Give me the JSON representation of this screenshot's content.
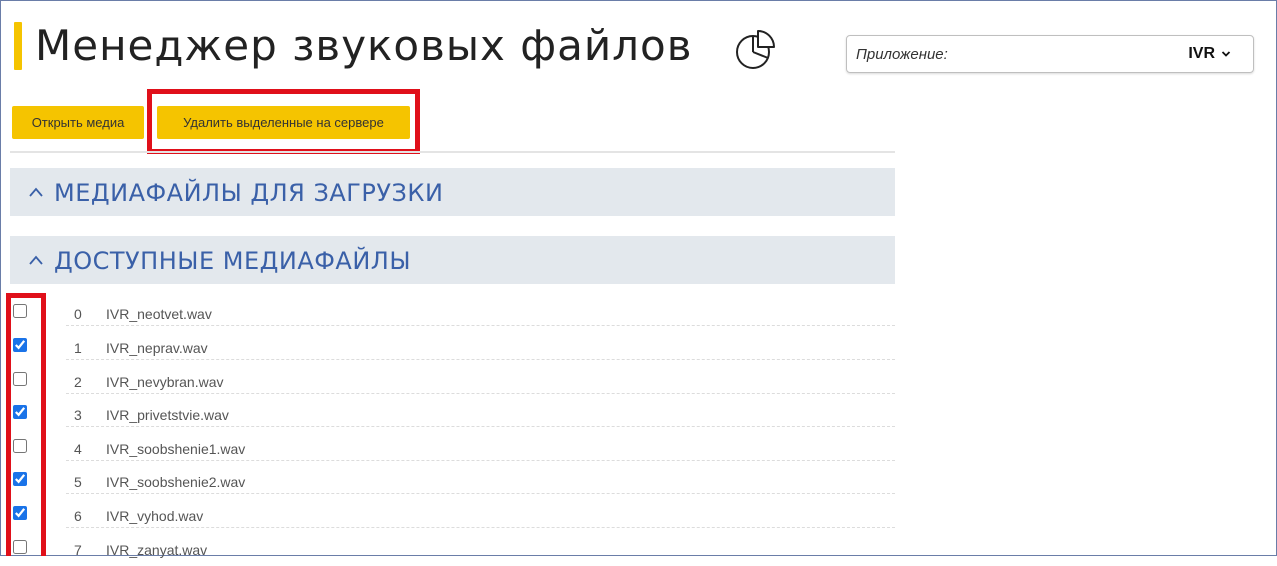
{
  "header": {
    "title": "Менеджер звуковых файлов",
    "icon": "pie-chart-icon"
  },
  "app_selector": {
    "label": "Приложение:",
    "value": "IVR"
  },
  "toolbar": {
    "open_media_label": "Открыть медиа",
    "delete_selected_label": "Удалить выделенные на сервере"
  },
  "sections": [
    {
      "title": "МЕДИАФАЙЛЫ ДЛЯ ЗАГРУЗКИ",
      "expanded": true
    },
    {
      "title": "ДОСТУПНЫЕ МЕДИАФАЙЛЫ",
      "expanded": true
    }
  ],
  "files": [
    {
      "index": "0",
      "name": "IVR_neotvet.wav",
      "checked": false
    },
    {
      "index": "1",
      "name": "IVR_neprav.wav",
      "checked": true
    },
    {
      "index": "2",
      "name": "IVR_nevybran.wav",
      "checked": false
    },
    {
      "index": "3",
      "name": "IVR_privetstvie.wav",
      "checked": true
    },
    {
      "index": "4",
      "name": "IVR_soobshenie1.wav",
      "checked": false
    },
    {
      "index": "5",
      "name": "IVR_soobshenie2.wav",
      "checked": true
    },
    {
      "index": "6",
      "name": "IVR_vyhod.wav",
      "checked": true
    },
    {
      "index": "7",
      "name": "IVR_zanyat.wav",
      "checked": false
    }
  ],
  "colors": {
    "accent": "#f5c400",
    "highlight": "#e0101a",
    "section_title": "#3a60a8",
    "section_bg": "#e3e8ed"
  }
}
